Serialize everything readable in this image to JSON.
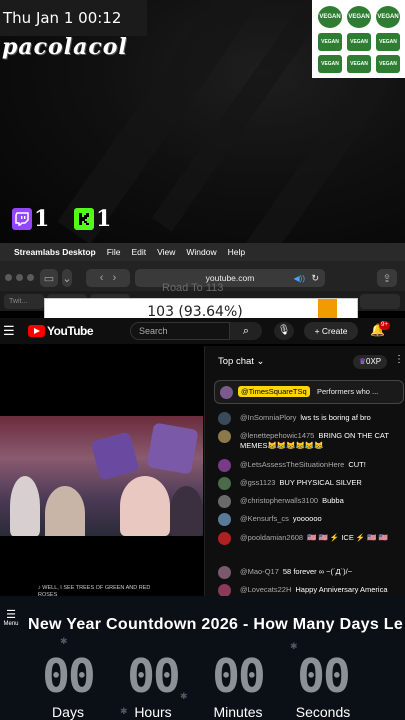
{
  "overlay": {
    "clock": "Thu Jan 1  00:12",
    "channel": "pacolacol",
    "twitch_count": "1",
    "kick_count": "1",
    "vegan_badge_label": "VEGAN"
  },
  "mac": {
    "apple": "",
    "app_name": "Streamlabs Desktop",
    "menus": [
      "File",
      "Edit",
      "View",
      "Window",
      "Help"
    ],
    "url": "youtube.com",
    "tab_label": "Twit..."
  },
  "goal": {
    "faded_label": "Road To 113",
    "text": "103 (93.64%)",
    "progress_fraction": 0.9364,
    "bar_color": "#f29b00"
  },
  "youtube": {
    "logo": "YouTube",
    "search_placeholder": "Search",
    "create_label": "Create",
    "notif_badge": "9+",
    "lyrics": "♪ WELL, I SEE TREES OF GREEN AND RED ROSES"
  },
  "chat": {
    "title": "Top chat",
    "xp": "0XP",
    "pinned": {
      "name": "@TimesSquareTSq",
      "text": "Performers who ..."
    },
    "messages": [
      {
        "name": "@InSomniaPlory",
        "text": "lws ts is boring af bro",
        "color": "#3a4a5a"
      },
      {
        "name": "@lenettepehowic1475",
        "text": "BRING ON THE CAT MEMES😹😹😹😹😹😹",
        "color": "#8a7a4a"
      },
      {
        "name": "@LetsAssessTheSituationHere",
        "text": "CUT!",
        "color": "#7a3a8a"
      },
      {
        "name": "@gss1123",
        "text": "BUY PHYSICAL SILVER",
        "color": "#4a6a4a"
      },
      {
        "name": "@christopherwalls3100",
        "text": "Bubba",
        "color": "#6a6a6a"
      },
      {
        "name": "@Kensurfs_cs",
        "text": "yoooooo",
        "color": "#5a7a9a"
      },
      {
        "name": "@pooldamian2608",
        "text": "🇺🇸 🇺🇸 ⚡ ICE ⚡ 🇺🇸 🇺🇸",
        "color": "#b02020"
      },
      {
        "name": "@Mao-Q17",
        "text": "58 forever ∞ ~(´Д`)/~",
        "color": "#7a5a6a"
      },
      {
        "name": "@Lovecats22H",
        "text": "Happy Anniversary America",
        "color": "#8a3a5a"
      }
    ]
  },
  "countdown": {
    "menu_label": "Menu",
    "title": "New Year Countdown 2026 - How Many Days Le",
    "units": [
      {
        "value": "00",
        "label": "Days"
      },
      {
        "value": "00",
        "label": "Hours"
      },
      {
        "value": "00",
        "label": "Minutes"
      },
      {
        "value": "00",
        "label": "Seconds"
      }
    ]
  }
}
